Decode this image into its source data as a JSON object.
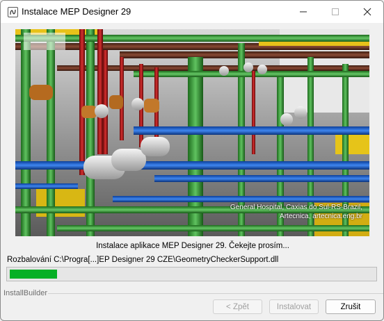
{
  "window": {
    "title": "Instalace MEP Designer 29",
    "icon": "app-logo-icon"
  },
  "titlebar_buttons": {
    "minimize": "minimize-icon",
    "maximize": "maximize-icon",
    "close": "close-icon"
  },
  "banner": {
    "caption_line1": "General Hospital, Caxias do Sul-RS-Brazil,",
    "caption_line2": "Artecnica, artecnica.eng.br"
  },
  "status": {
    "message": "Instalace aplikace MEP Designer 29. Čekejte prosím...",
    "current_file": "Rozbalování C:\\Progra[...]EP Designer 29 CZE\\GeometryCheckerSupport.dll"
  },
  "progress": {
    "fraction": 0.02,
    "color": "#06b025"
  },
  "footer": {
    "brand": "InstallBuilder"
  },
  "buttons": {
    "back_label": "< Zpět",
    "install_label": "Instalovat",
    "cancel_label": "Zrušit"
  }
}
